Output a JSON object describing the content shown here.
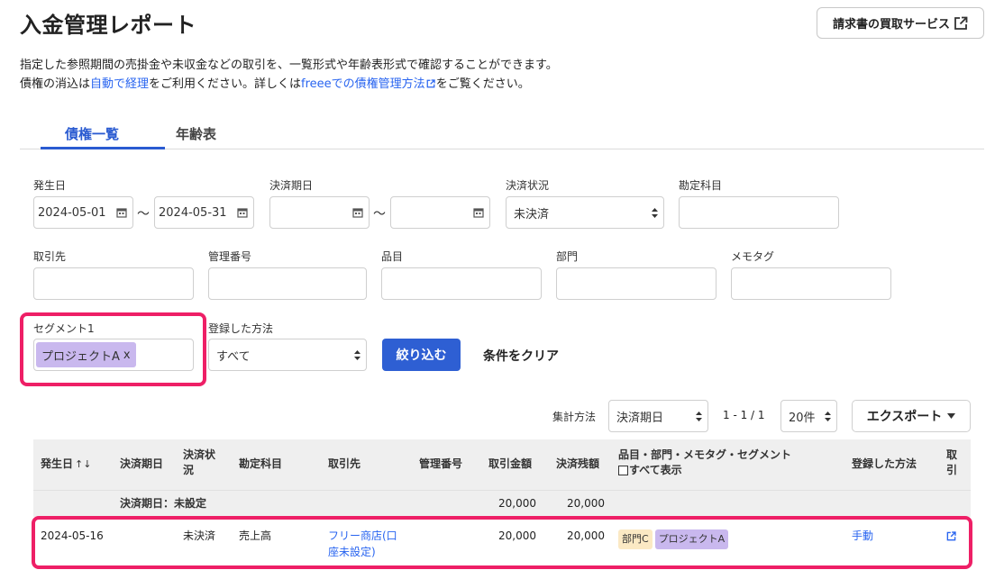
{
  "header": {
    "title": "入金管理レポート",
    "external_button": "請求書の買取サービス",
    "desc_line1": "指定した参照期間の売掛金や未収金などの取引を、一覧形式や年齢表形式で確認することができます。",
    "desc2_pre": "債権の消込は",
    "desc2_link1": "自動で経理",
    "desc2_mid": "をご利用ください。詳しくは",
    "desc2_link2": "freeeでの債権管理方法",
    "desc2_post": "をご覧ください。"
  },
  "tabs": {
    "tab1": "債権一覧",
    "tab2": "年齢表"
  },
  "filters": {
    "occurrence_date_label": "発生日",
    "occurrence_from": "2024-05-01",
    "occurrence_to": "2024-05-31",
    "tilde": "〜",
    "due_date_label": "決済期日",
    "due_from": "",
    "due_to": "",
    "settlement_status_label": "決済状況",
    "settlement_status_value": "未決済",
    "account_label": "勘定科目",
    "partner_label": "取引先",
    "manage_no_label": "管理番号",
    "item_label": "品目",
    "department_label": "部門",
    "memo_tag_label": "メモタグ",
    "segment1_label": "セグメント1",
    "segment1_chip": "プロジェクトA",
    "chip_remove": "x",
    "registration_label": "登録した方法",
    "registration_value": "すべて",
    "apply_button": "絞り込む",
    "clear_button": "条件をクリア"
  },
  "table_toolbar": {
    "aggregation_label": "集計方法",
    "aggregation_value": "決済期日",
    "range_text": "1 - 1 / 1",
    "per_page": "20件",
    "export_button": "エクスポート"
  },
  "table": {
    "headers": {
      "occurrence_date": "発生日",
      "sort_arrows": "↑↓",
      "due_date": "決済期日",
      "status_l1": "決済状",
      "status_l2": "況",
      "account": "勘定科目",
      "partner": "取引先",
      "manage_no": "管理番号",
      "amount": "取引金額",
      "balance": "決済残額",
      "items_l1": "品目・部門・メモタグ・セグメント",
      "show_all": "すべて表示",
      "registration": "登録した方法",
      "deal_l1": "取",
      "deal_l2": "引"
    },
    "group_row": {
      "label": "決済期日：未設定",
      "amount": "20,000",
      "balance": "20,000"
    },
    "rows": [
      {
        "occurrence_date": "2024-05-16",
        "due_date": "",
        "status": "未決済",
        "account": "売上高",
        "partner_l1": "フリー商店(口",
        "partner_l2": "座未設定)",
        "manage_no": "",
        "amount": "20,000",
        "balance": "20,000",
        "tag_department": "部門C",
        "tag_segment": "プロジェクトA",
        "registration": "手動"
      }
    ]
  },
  "colors": {
    "accent_blue": "#2e5fd3",
    "highlight_pink": "#ee1f66",
    "segment_chip": "#c9b8ee",
    "department_tag": "#fbe9c4"
  },
  "icons": {
    "external": "external-link-icon",
    "calendar": "calendar-icon",
    "select": "updown-caret-icon",
    "dropdown": "triangle-down-icon"
  }
}
